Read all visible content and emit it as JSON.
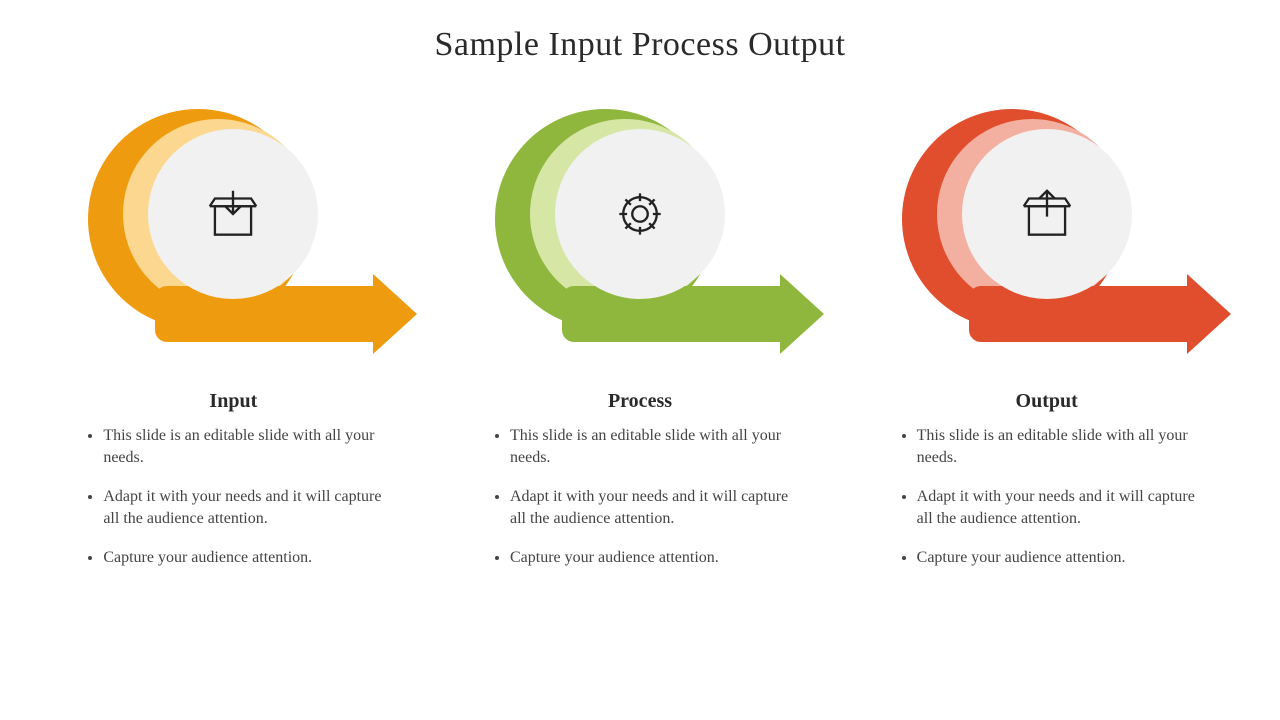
{
  "title": "Sample Input Process Output",
  "colors": {
    "orange": "#ef9b0f",
    "orange_tint": "#fbd78f",
    "green": "#8fb73e",
    "green_tint": "#d6e6a5",
    "red": "#e04e2e",
    "red_tint": "#f3b0a0"
  },
  "stages": [
    {
      "heading": "Input",
      "icon": "box-in-icon",
      "color_key": "orange",
      "bullets": [
        "This slide is an editable slide with all your needs.",
        "Adapt it with your needs and it will capture all the audience attention.",
        "Capture your audience attention."
      ]
    },
    {
      "heading": "Process",
      "icon": "gear-icon",
      "color_key": "green",
      "bullets": [
        "This slide is an editable slide with all your needs.",
        "Adapt it with your needs and it will capture all the audience attention.",
        "Capture your audience attention."
      ]
    },
    {
      "heading": "Output",
      "icon": "box-out-icon",
      "color_key": "red",
      "bullets": [
        "This slide is an editable slide with all your needs.",
        "Adapt it with your needs and it will capture all the audience attention.",
        "Capture your audience attention."
      ]
    }
  ]
}
